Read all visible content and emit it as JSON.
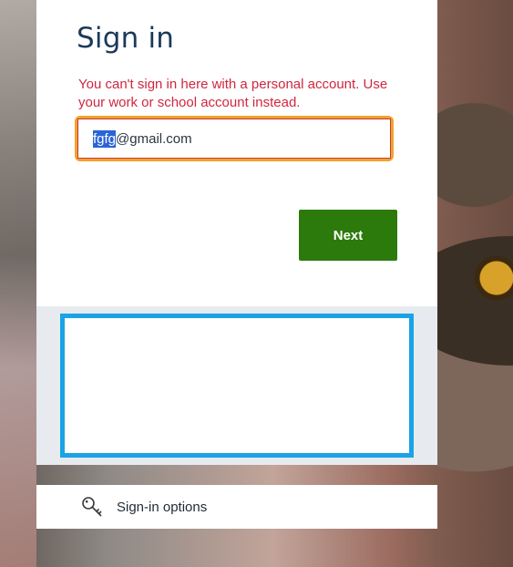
{
  "signin": {
    "title": "Sign in",
    "error": "You can't sign in here with a personal account. Use your work or school account instead.",
    "email": {
      "selected_part": "fgfg",
      "rest": "@gmail.com"
    },
    "next_label": "Next"
  },
  "options": {
    "label": "Sign-in options",
    "icon": "key-icon"
  },
  "colors": {
    "primary": "#2b7a0b",
    "error": "#d0273f",
    "focus_ring": "#f3a22b",
    "frame_border": "#1aa3e6"
  }
}
